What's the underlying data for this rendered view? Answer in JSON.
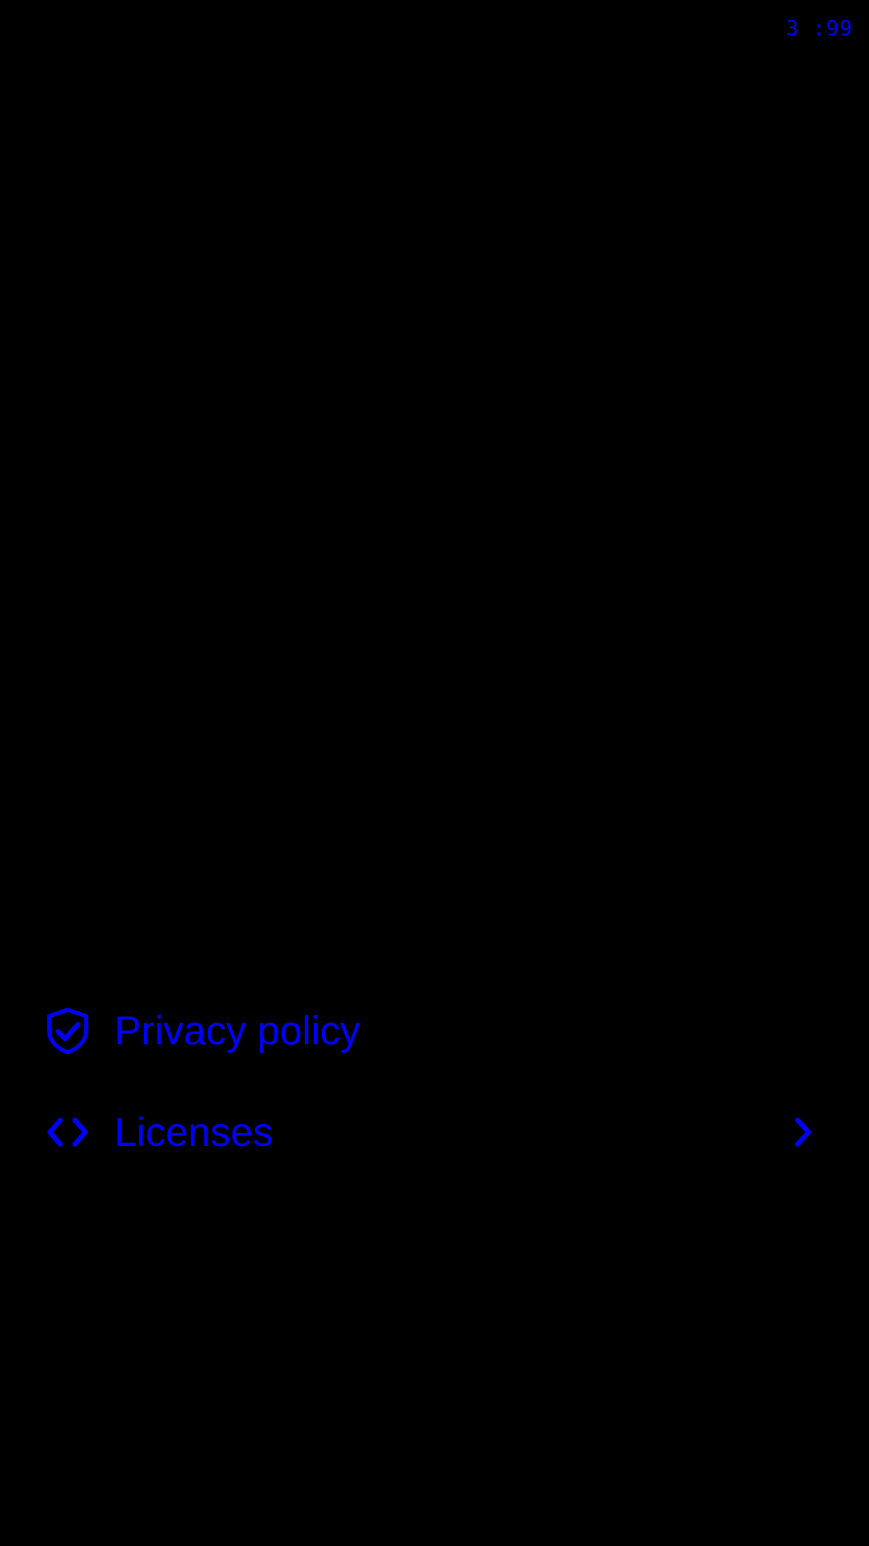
{
  "status_bar": {
    "text": "3 :99",
    "accent_color": "#0000ff",
    "background_color": "#000000"
  },
  "menu": {
    "items": [
      {
        "label": "Privacy policy",
        "icon": "shield-check-icon",
        "has_chevron": false
      },
      {
        "label": "Licenses",
        "icon": "code-icon",
        "has_chevron": true
      }
    ]
  }
}
